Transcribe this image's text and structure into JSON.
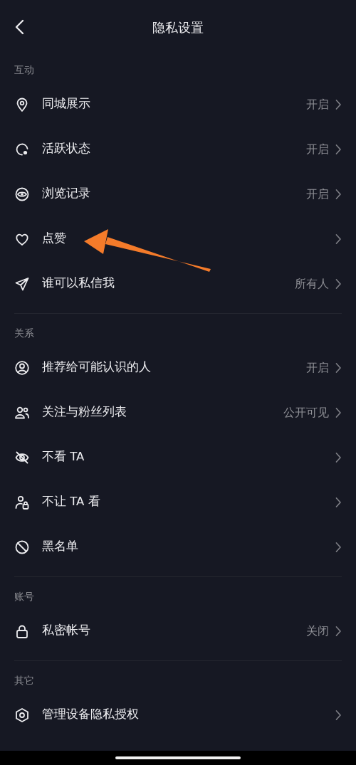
{
  "header": {
    "title": "隐私设置"
  },
  "sections": [
    {
      "title": "互动",
      "items": [
        {
          "label": "同城展示",
          "value": "开启"
        },
        {
          "label": "活跃状态",
          "value": "开启"
        },
        {
          "label": "浏览记录",
          "value": "开启"
        },
        {
          "label": "点赞"
        },
        {
          "label": "谁可以私信我",
          "value": "所有人"
        }
      ]
    },
    {
      "title": "关系",
      "items": [
        {
          "label": "推荐给可能认识的人",
          "value": "开启"
        },
        {
          "label": "关注与粉丝列表",
          "value": "公开可见"
        },
        {
          "label": "不看 TA"
        },
        {
          "label": "不让 TA 看"
        },
        {
          "label": "黑名单"
        }
      ]
    },
    {
      "title": "账号",
      "items": [
        {
          "label": "私密帐号",
          "value": "关闭"
        }
      ]
    },
    {
      "title": "其它",
      "items": [
        {
          "label": "管理设备隐私授权"
        }
      ]
    }
  ]
}
